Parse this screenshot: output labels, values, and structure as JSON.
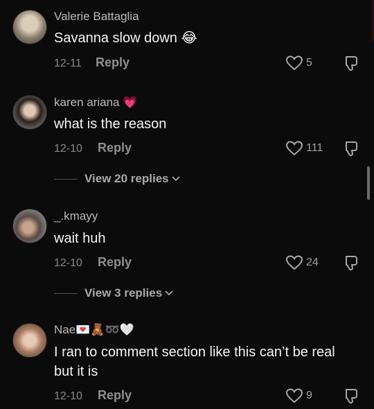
{
  "comments": [
    {
      "username": "Valerie Battaglia",
      "text": "Savanna slow down 😂",
      "date": "12-11",
      "reply_label": "Reply",
      "likes": "5"
    },
    {
      "username": "karen ariana 💗",
      "text": "what is the reason",
      "date": "12-10",
      "reply_label": "Reply",
      "likes": "111",
      "view_replies": "View 20 replies"
    },
    {
      "username": "_.kmayy",
      "text": "wait huh",
      "date": "12-10",
      "reply_label": "Reply",
      "likes": "24",
      "view_replies": "View 3 replies"
    },
    {
      "username": "Nae💌🧸➿🤍",
      "text": "I ran to comment section like this can’t be real but it is",
      "date": "12-10",
      "reply_label": "Reply",
      "likes": "9"
    }
  ],
  "icons": {
    "like": "heart-outline-icon",
    "dislike": "thumbs-down-outline-icon",
    "chevron": "chevron-down-icon"
  },
  "colors": {
    "background": "#0b0b0b",
    "text": "#f4f4f4",
    "muted": "#8a8a8a"
  }
}
